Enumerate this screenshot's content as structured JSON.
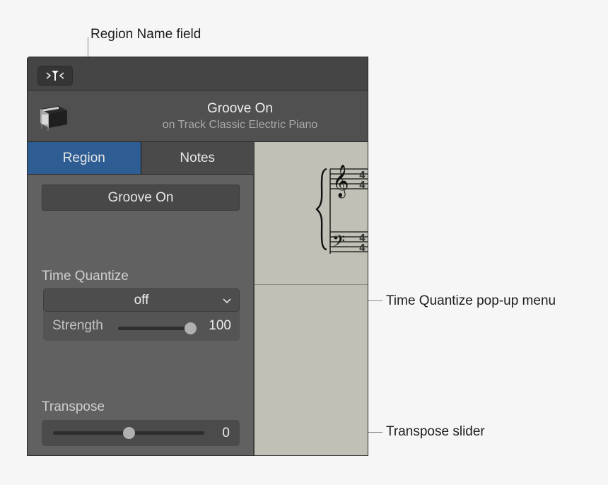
{
  "callouts": {
    "region_name": "Region Name field",
    "time_quantize": "Time Quantize pop-up menu",
    "transpose": "Transpose slider"
  },
  "toolbar": {
    "filter_icon": "catch-filter-icon"
  },
  "header": {
    "instrument_icon": "electric-piano-icon",
    "title": "Groove On",
    "subtitle": "on Track Classic Electric Piano"
  },
  "tabs": [
    {
      "label": "Region",
      "active": true
    },
    {
      "label": "Notes",
      "active": false
    }
  ],
  "inspector": {
    "region_name_value": "Groove On",
    "time_quantize": {
      "label": "Time Quantize",
      "selected": "off",
      "strength_label": "Strength",
      "strength_value": "100",
      "strength_percent": 100
    },
    "transpose": {
      "label": "Transpose",
      "value": "0",
      "position_fraction": 0.5
    }
  },
  "score": {
    "staves": [
      "treble",
      "bass"
    ],
    "time_signature": "4/4"
  },
  "colors": {
    "active_tab": "#2d5d92",
    "panel_bg": "#616161",
    "score_bg": "#c0c0b6"
  }
}
